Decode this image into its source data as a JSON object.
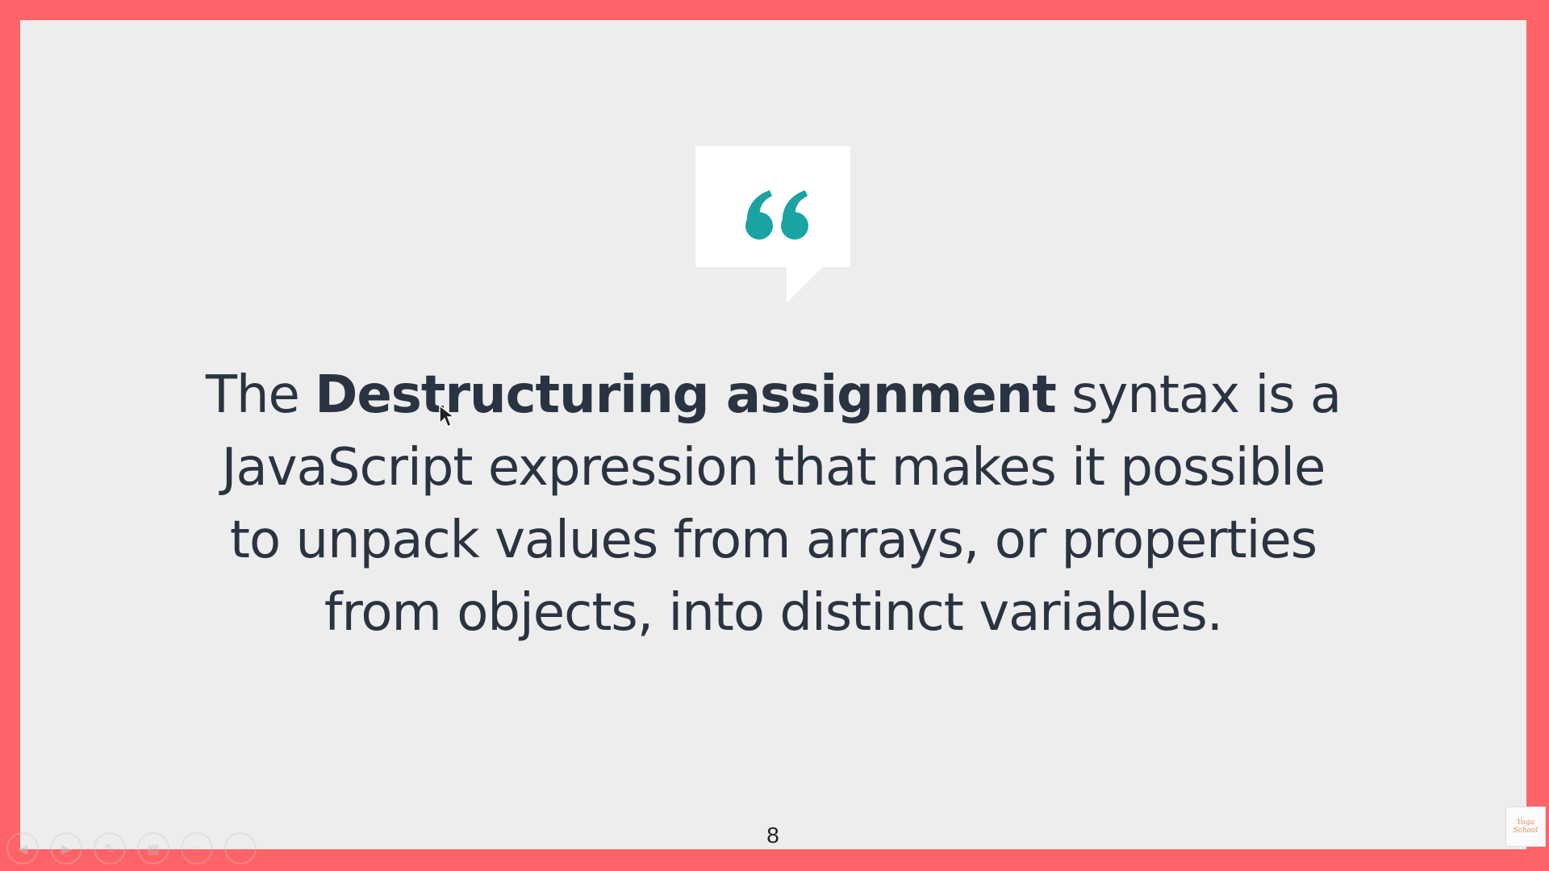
{
  "slide": {
    "quote": {
      "prefix": "The ",
      "bold": "Destructuring assignment",
      "line1_rest": " syntax is a",
      "line2": "JavaScript expression that makes it possible",
      "line3": "to unpack values from arrays, or properties",
      "line4": "from objects, into distinct variables."
    },
    "page_number": "8",
    "quote_mark": "“"
  },
  "toolbar": {
    "buttons": [
      {
        "icon": "previous-icon",
        "glyph": "◀"
      },
      {
        "icon": "next-icon",
        "glyph": "▶"
      },
      {
        "icon": "pen-icon",
        "glyph": "✎"
      },
      {
        "icon": "slides-grid-icon",
        "glyph": "▦"
      },
      {
        "icon": "zoom-icon",
        "glyph": "⌕"
      },
      {
        "icon": "more-icon",
        "glyph": "⋯"
      }
    ]
  },
  "logo": {
    "line1": "Yoga",
    "line2": "School"
  },
  "colors": {
    "frame": "#fe6467",
    "slide_bg": "#ededed",
    "accent": "#1ba3a3",
    "text": "#2a3342"
  }
}
